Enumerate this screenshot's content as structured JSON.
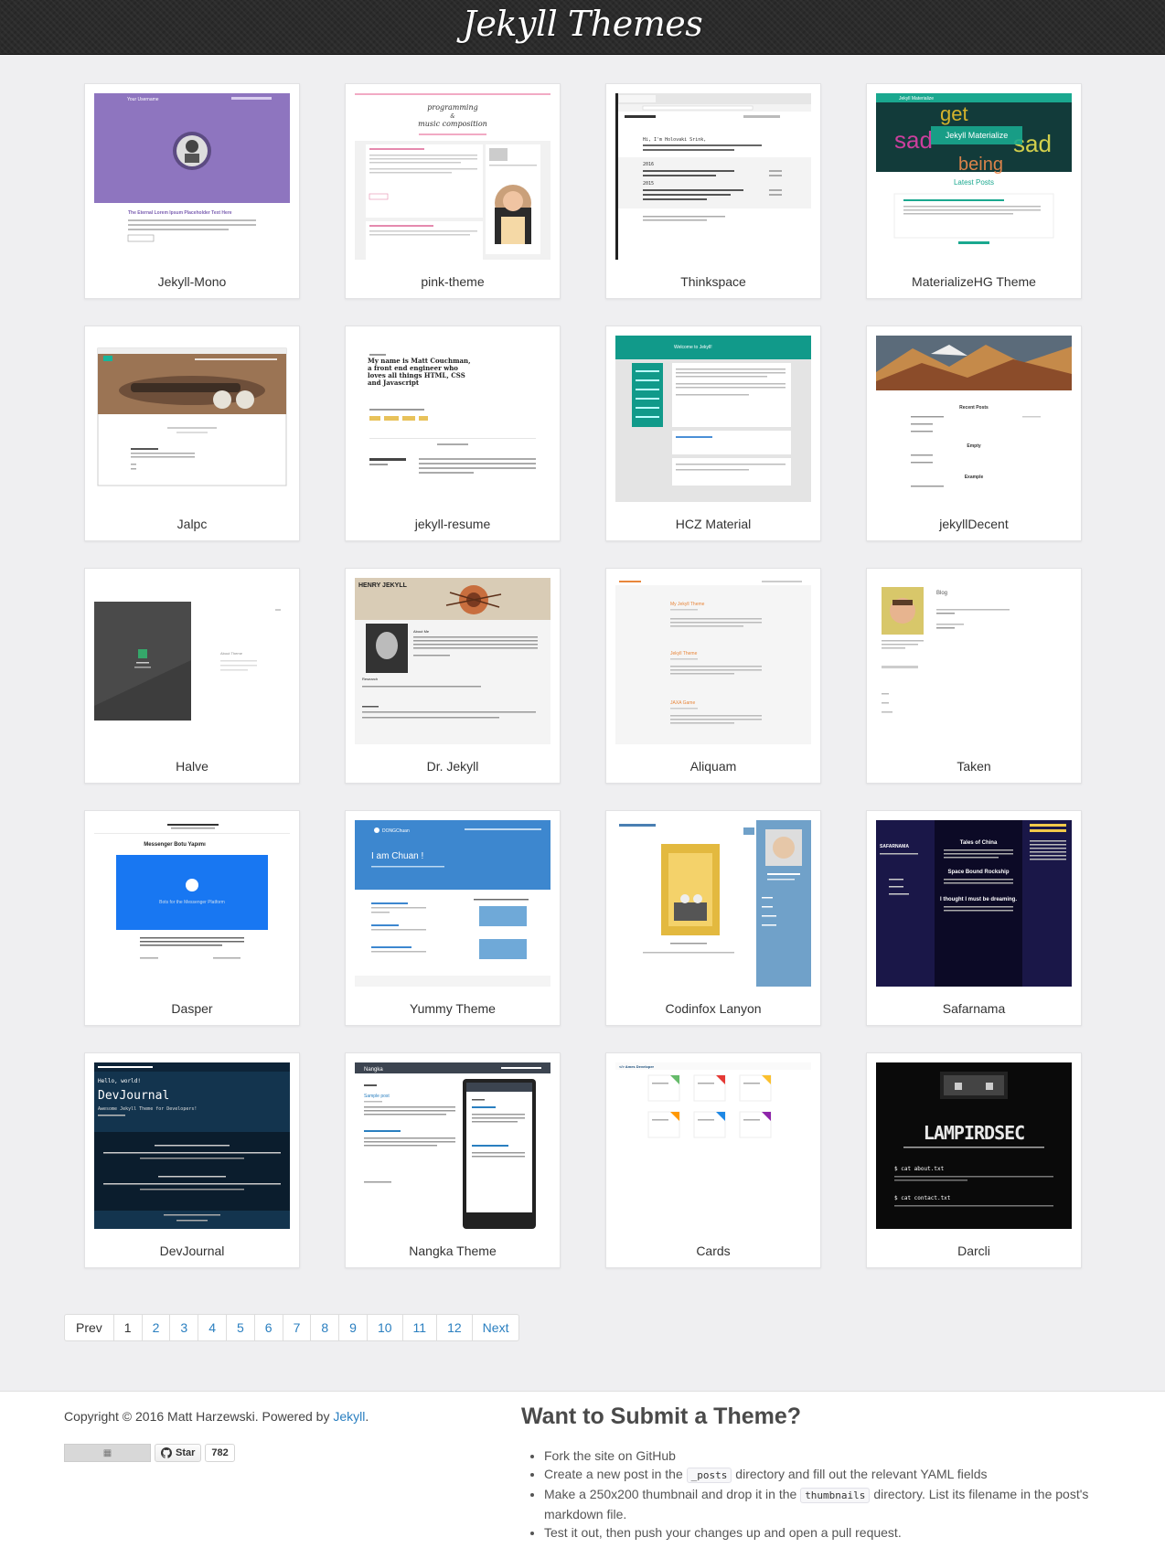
{
  "header": {
    "title": "Jekyll Themes"
  },
  "themes": [
    {
      "name": "Jekyll-Mono"
    },
    {
      "name": "pink-theme"
    },
    {
      "name": "Thinkspace"
    },
    {
      "name": "MaterializeHG Theme"
    },
    {
      "name": "Jalpc"
    },
    {
      "name": "jekyll-resume"
    },
    {
      "name": "HCZ Material"
    },
    {
      "name": "jekyllDecent"
    },
    {
      "name": "Halve"
    },
    {
      "name": "Dr. Jekyll"
    },
    {
      "name": "Aliquam"
    },
    {
      "name": "Taken"
    },
    {
      "name": "Dasper"
    },
    {
      "name": "Yummy Theme"
    },
    {
      "name": "Codinfox Lanyon"
    },
    {
      "name": "Safarnama"
    },
    {
      "name": "DevJournal"
    },
    {
      "name": "Nangka Theme"
    },
    {
      "name": "Cards"
    },
    {
      "name": "Darcli"
    }
  ],
  "thumb_text": {
    "mono_title": "The Eternal Lorem Ipsum Placeholder Text Here",
    "mono_user": "Your Username",
    "pink_title1": "programming",
    "pink_title2": "&",
    "pink_title3": "music composition",
    "think_intro": "Hi, I'm Holovaki Srink,",
    "think_year1": "2016",
    "think_year2": "2015",
    "mat_header": "Jekyll Materialize",
    "mat_latest": "Latest Posts",
    "resume_intro": "My name is Matt Couchman, a front end engineer who loves all things HTML, CSS and Javascript",
    "hcz_welcome": "Welcome to Jekyll!",
    "decent_recent": "Recent Posts",
    "decent_empty": "Empty",
    "decent_example": "Example",
    "drjekyll_title": "HENRY JEKYLL",
    "drjekyll_about": "About Me",
    "drjekyll_research": "Research",
    "taken_blog": "Blog",
    "dasper_title": "Messenger Botu Yapımı",
    "dasper_banner": "Bots for the Messenger Platform",
    "yummy_brand": "DONGChuan",
    "yummy_hero": "I am Chuan !",
    "safar_brand": "SAFARNAMA",
    "safar_tales": "Tales of China",
    "safar_space": "Space Bound Rockship",
    "safar_dream": "I thought I must be dreaming.",
    "dev_hello": "Hello, world!",
    "dev_title": "DevJournal",
    "dev_sub": "Awesome Jekyll Theme for Developers!",
    "nangka_brand": "Nangka",
    "nangka_post": "Sample post",
    "cards_brand": "</> Ames Developer",
    "darcli_logo": "LAMPIRDSEC",
    "darcli_cmd1": "$ cat about.txt",
    "darcli_cmd2": "$ cat contact.txt",
    "aliquam_post1": "My Jekyll Theme",
    "aliquam_post2": "Jekyll Theme",
    "aliquam_post3": "JAXA Game",
    "halve_about": "About Theme"
  },
  "pagination": {
    "prev": "Prev",
    "pages": [
      "1",
      "2",
      "3",
      "4",
      "5",
      "6",
      "7",
      "8",
      "9",
      "10",
      "11",
      "12"
    ],
    "next": "Next"
  },
  "footer": {
    "copyright_prefix": "Copyright © 2016 Matt Harzewski. Powered by",
    "copyright_link": "Jekyll",
    "copyright_suffix": ".",
    "star_label": "Star",
    "star_count": "782",
    "submit_title": "Want to Submit a Theme?",
    "steps": [
      {
        "text": "Fork the site on GitHub"
      },
      {
        "pre": "Create a new post in the",
        "code": "_posts",
        "post": "directory and fill out the relevant YAML fields"
      },
      {
        "pre": "Make a 250x200 thumbnail and drop it in the",
        "code": "thumbnails",
        "post": "directory. List its filename in the post's markdown file."
      },
      {
        "text": "Test it out, then push your changes up and open a pull request."
      }
    ]
  }
}
